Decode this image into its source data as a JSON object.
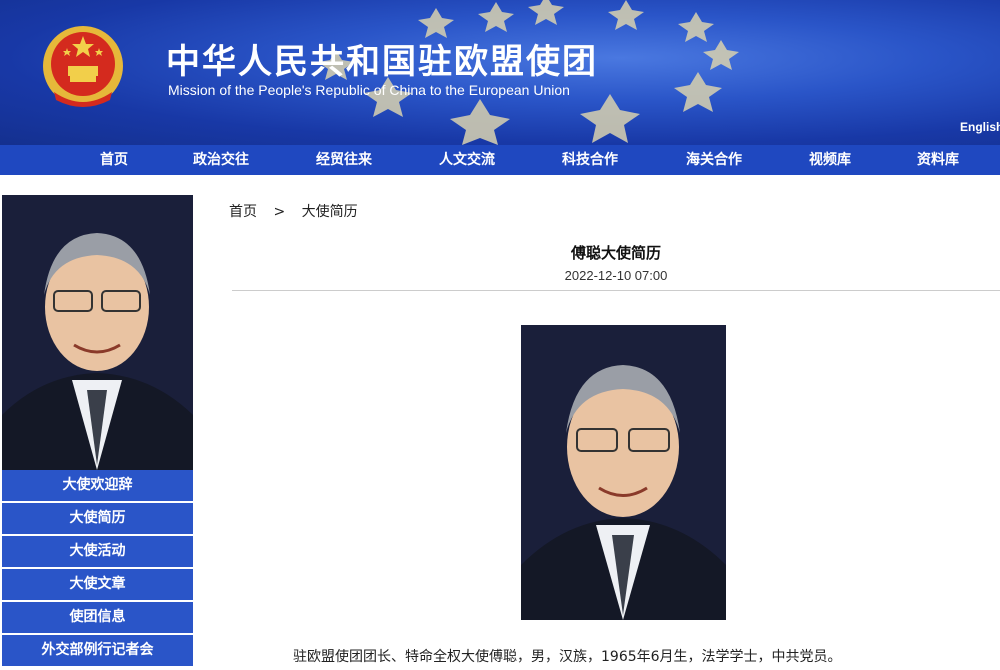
{
  "header": {
    "title": "中华人民共和国驻欧盟使团",
    "subtitle": "Mission of the People's Republic of China to the European Union",
    "language_link": "English"
  },
  "nav": {
    "items": [
      {
        "label": "首页"
      },
      {
        "label": "政治交往"
      },
      {
        "label": "经贸往来"
      },
      {
        "label": "人文交流"
      },
      {
        "label": "科技合作"
      },
      {
        "label": "海关合作"
      },
      {
        "label": "视频库"
      },
      {
        "label": "资料库"
      }
    ]
  },
  "sidebar": {
    "items": [
      {
        "label": "大使欢迎辞"
      },
      {
        "label": "大使简历"
      },
      {
        "label": "大使活动"
      },
      {
        "label": "大使文章"
      },
      {
        "label": "使团信息"
      },
      {
        "label": "外交部例行记者会"
      }
    ]
  },
  "breadcrumb": {
    "home": "首页",
    "separator": ">",
    "current": "大使简历"
  },
  "article": {
    "title": "傅聪大使简历",
    "date": "2022-12-10 07:00",
    "paragraph": "驻欧盟使团团长、特命全权大使傅聪，男，汉族，1965年6月生，法学学士，中共党员。"
  },
  "colors": {
    "nav_blue": "#1f48c0",
    "sidebar_blue": "#2a55c8",
    "header_blue": "#2a55c8",
    "star_gold": "#e6c44a"
  }
}
